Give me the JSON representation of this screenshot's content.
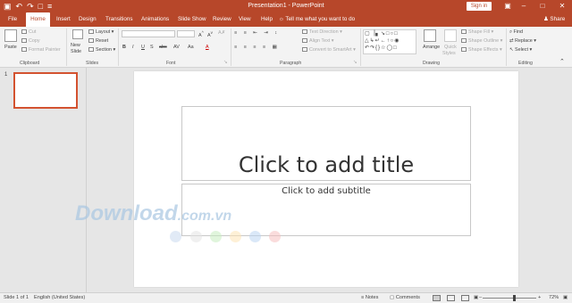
{
  "titlebar": {
    "title": "Presentation1 - PowerPoint",
    "signin": "Sign in",
    "qat": [
      "save-icon",
      "undo-icon",
      "redo-icon",
      "start-from-beginning-icon",
      "customize-icon"
    ]
  },
  "tabs": [
    "File",
    "Home",
    "Insert",
    "Design",
    "Transitions",
    "Animations",
    "Slide Show",
    "Review",
    "View",
    "Help"
  ],
  "tellme": "Tell me what you want to do",
  "share": "Share",
  "ribbon": {
    "clipboard": {
      "paste": "Paste",
      "cut": "Cut",
      "copy": "Copy",
      "format_painter": "Format Painter",
      "label": "Clipboard"
    },
    "slides": {
      "new_slide": "New",
      "new_slide_2": "Slide",
      "layout": "Layout",
      "reset": "Reset",
      "section": "Section",
      "label": "Slides"
    },
    "font": {
      "label": "Font",
      "buttons": [
        "B",
        "I",
        "U",
        "S",
        "abc",
        "AV",
        "Aa",
        "A"
      ]
    },
    "paragraph": {
      "text_direction": "Text Direction",
      "align_text": "Align Text",
      "smartart": "Convert to SmartArt",
      "label": "Paragraph"
    },
    "drawing": {
      "arrange": "Arrange",
      "quick_styles": "Quick",
      "quick_styles_2": "Styles",
      "shape_fill": "Shape Fill",
      "shape_outline": "Shape Outline",
      "shape_effects": "Shape Effects",
      "label": "Drawing"
    },
    "editing": {
      "find": "Find",
      "replace": "Replace",
      "select": "Select",
      "label": "Editing"
    }
  },
  "thumbnail": {
    "number": "1"
  },
  "slide": {
    "title_placeholder": "Click to add title",
    "subtitle_placeholder": "Click to add subtitle"
  },
  "watermark": {
    "main": "Download",
    "tld": ".com.vn",
    "dot_colors": [
      "#c9d9ee",
      "#e3e3e3",
      "#c7ecc0",
      "#fde3b4",
      "#bcd6f3",
      "#f5c0c0"
    ]
  },
  "statusbar": {
    "slide_info": "Slide 1 of 1",
    "language": "English (United States)",
    "notes": "Notes",
    "comments": "Comments",
    "zoom": "72%"
  }
}
